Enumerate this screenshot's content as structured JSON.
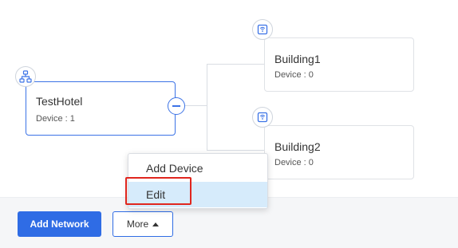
{
  "tree": {
    "root": {
      "title": "TestHotel",
      "device_line": "Device : 1",
      "icon": "network-topology-icon"
    },
    "children": [
      {
        "title": "Building1",
        "device_line": "Device : 0",
        "icon": "building-icon"
      },
      {
        "title": "Building2",
        "device_line": "Device : 0",
        "icon": "building-icon"
      }
    ]
  },
  "context_menu": {
    "items": [
      {
        "label": "Add Device"
      },
      {
        "label": "Edit"
      }
    ]
  },
  "footer": {
    "add_network_label": "Add Network",
    "more_label": "More"
  },
  "colors": {
    "accent": "#2f6ce5",
    "menu_hover": "#d6ebfb",
    "highlight": "#e0261e"
  }
}
